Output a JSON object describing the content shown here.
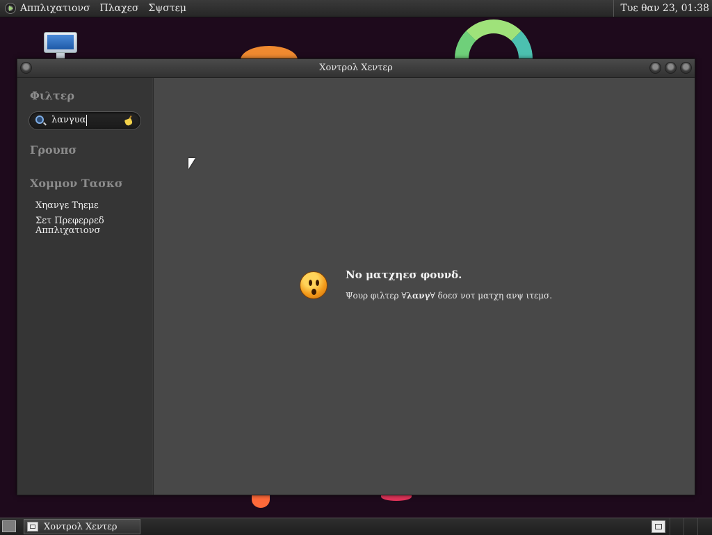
{
  "top_panel": {
    "menus": [
      "Αππλιχατιονσ",
      "Πλαχεσ",
      "Σψστεμ"
    ],
    "clock": "Τυε θαν 23, 01:38"
  },
  "window": {
    "title": "Χοντρολ Χεντερ",
    "sidebar": {
      "filter_heading": "Φιλτερ",
      "search_value": "λανγυα",
      "groups_heading": "Γρουπσ",
      "common_tasks_heading": "Χομμον Τασκσ",
      "tasks": [
        "Χηανγε Τηεμε",
        "Σετ Πρεφερρεδ",
        "Αππλιχατιονσ"
      ]
    },
    "content": {
      "message_title": "Νο ματχηεσ φουνδ.",
      "message_prefix": "Ψουρ φιλτερ ∀",
      "message_term": "λανγ",
      "message_suffix": "∀ δοεσ νοτ ματχη ανψ ιτεμσ."
    }
  },
  "taskbar": {
    "task_label": "Χοντρολ Χεντερ"
  }
}
